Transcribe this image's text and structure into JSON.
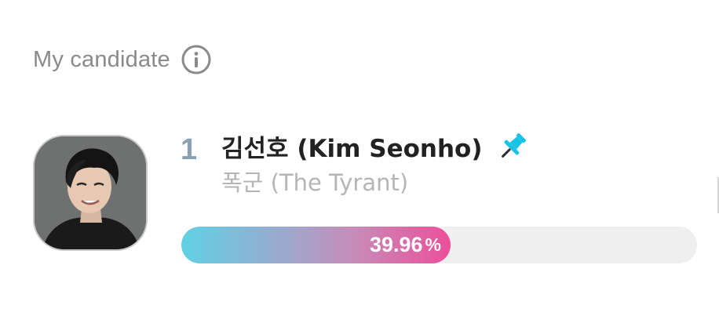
{
  "section": {
    "title": "My candidate",
    "info_icon": "info-circle-icon"
  },
  "candidate": {
    "rank": "1",
    "name": "김선호 (Kim Seonho)",
    "pin_icon": "pushpin-icon",
    "drama": "폭군 (The Tyrant)",
    "vote_percent": 39.96,
    "vote_percent_text": "39.96",
    "percent_sign": "%"
  },
  "colors": {
    "gradient_start": "#5fd1e4",
    "gradient_end": "#ec4f9a",
    "pin": "#19c3e6",
    "rank": "#8aa0b4"
  }
}
